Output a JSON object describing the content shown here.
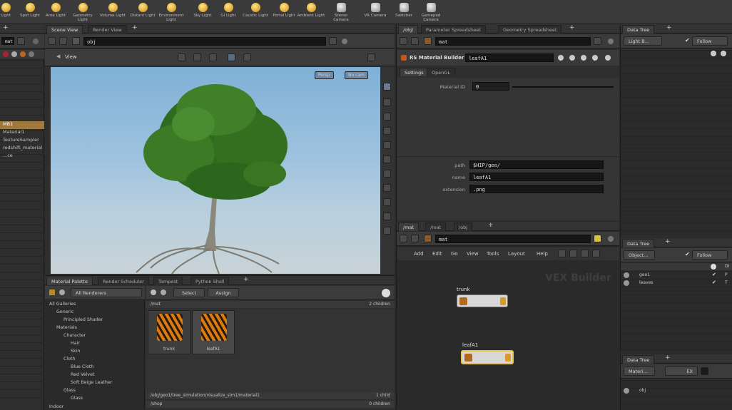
{
  "shelf": {
    "tools": [
      {
        "label": "Light",
        "icon": "light-icon"
      },
      {
        "label": "Spot Light",
        "icon": "spot-light-icon"
      },
      {
        "label": "Area Light",
        "icon": "area-light-icon"
      },
      {
        "label": "Geometry Light",
        "icon": "geometry-light-icon"
      },
      {
        "label": "Volume Light",
        "icon": "volume-light-icon"
      },
      {
        "label": "Distant Light",
        "icon": "distant-light-icon"
      },
      {
        "label": "Environment Light",
        "icon": "environment-light-icon"
      },
      {
        "label": "Sky Light",
        "icon": "sky-light-icon"
      },
      {
        "label": "GI Light",
        "icon": "gi-light-icon"
      },
      {
        "label": "Caustic Light",
        "icon": "caustic-light-icon"
      },
      {
        "label": "Portal Light",
        "icon": "portal-light-icon"
      },
      {
        "label": "Ambient Light",
        "icon": "ambient-light-icon"
      },
      {
        "label": "Stereo Camera",
        "icon": "stereo-camera-icon"
      },
      {
        "label": "VR Camera",
        "icon": "vr-camera-icon"
      },
      {
        "label": "Switcher",
        "icon": "switcher-icon"
      },
      {
        "label": "Gamepad Camera",
        "icon": "gamepad-camera-icon"
      }
    ]
  },
  "left_panel": {
    "path": "mat",
    "rows": [
      "MB1",
      "Material1",
      "TextureSampler",
      "redshift_material",
      "...ce"
    ]
  },
  "viewport": {
    "tabs": [
      "Scene View",
      "Render View"
    ],
    "path": "obj",
    "view_label": "View",
    "persp_label": "Persp",
    "cam_label": "No cam"
  },
  "material_palette": {
    "tabs": [
      "Material Palette",
      "Render Scheduler",
      "Tempest",
      "Python Shell"
    ],
    "filter": "All Renderers",
    "apply_btn": "Select",
    "assign_btn": "Assign",
    "section_label": "/mat",
    "count_label": "2 children",
    "tree": [
      {
        "label": "All Galleries",
        "indent": 0
      },
      {
        "label": "Generic",
        "indent": 1
      },
      {
        "label": "Principled Shader",
        "indent": 2
      },
      {
        "label": "Materials",
        "indent": 1
      },
      {
        "label": "Character",
        "indent": 2
      },
      {
        "label": "Hair",
        "indent": 3
      },
      {
        "label": "Skin",
        "indent": 3
      },
      {
        "label": "Cloth",
        "indent": 2
      },
      {
        "label": "Blue Cloth",
        "indent": 3
      },
      {
        "label": "Red Velvet",
        "indent": 3
      },
      {
        "label": "Soft Beige Leather",
        "indent": 3
      },
      {
        "label": "Glass",
        "indent": 2
      },
      {
        "label": "Glass",
        "indent": 3
      }
    ],
    "materials": [
      {
        "name": "trunk"
      },
      {
        "name": "leafA1"
      }
    ],
    "footer1": "/obj/geo1/tree_simulation/visualize_sim1/material1",
    "footer1_count": "1 child",
    "footer2": "/shop",
    "footer2_count": "0 children",
    "bottom_left": "Indoor"
  },
  "parameters": {
    "tabs": [
      "/obj/",
      "Parameter Spreadsheet",
      "Geometry Spreadsheet"
    ],
    "path": "mat",
    "node_type": "RS Material Builder",
    "node_name": "leafA1",
    "subtabs": [
      "Settings",
      "OpenGL"
    ],
    "material_id_label": "Material ID",
    "material_id_value": "0",
    "path_label": "path",
    "path_value": "$HIP/geo/",
    "name_label": "name",
    "name_value": "leafA1",
    "ext_label": "extension",
    "ext_value": ".png"
  },
  "network": {
    "tabs": [
      "/mat",
      "/mat",
      "/obj"
    ],
    "path": "mat",
    "menu": [
      "Add",
      "Edit",
      "Go",
      "View",
      "Tools",
      "Layout",
      "Help"
    ],
    "watermark": "VEX Builder",
    "nodes": [
      {
        "label": "trunk",
        "selected": false
      },
      {
        "label": "leafA1",
        "selected": true
      }
    ]
  },
  "data_tree_top": {
    "tab": "Data Tree",
    "dropdown": "Light B...",
    "follow": "Follow"
  },
  "data_tree_mid": {
    "tab": "Data Tree",
    "dropdown": "Object...",
    "follow": "Follow",
    "col_label": "Di",
    "items": [
      {
        "label": "geo1",
        "col": "P"
      },
      {
        "label": "leaves",
        "col": "T"
      }
    ]
  },
  "data_tree_bot": {
    "tab": "Data Tree",
    "dropdown": "Materi...",
    "ext": "EX",
    "item": "obj"
  }
}
